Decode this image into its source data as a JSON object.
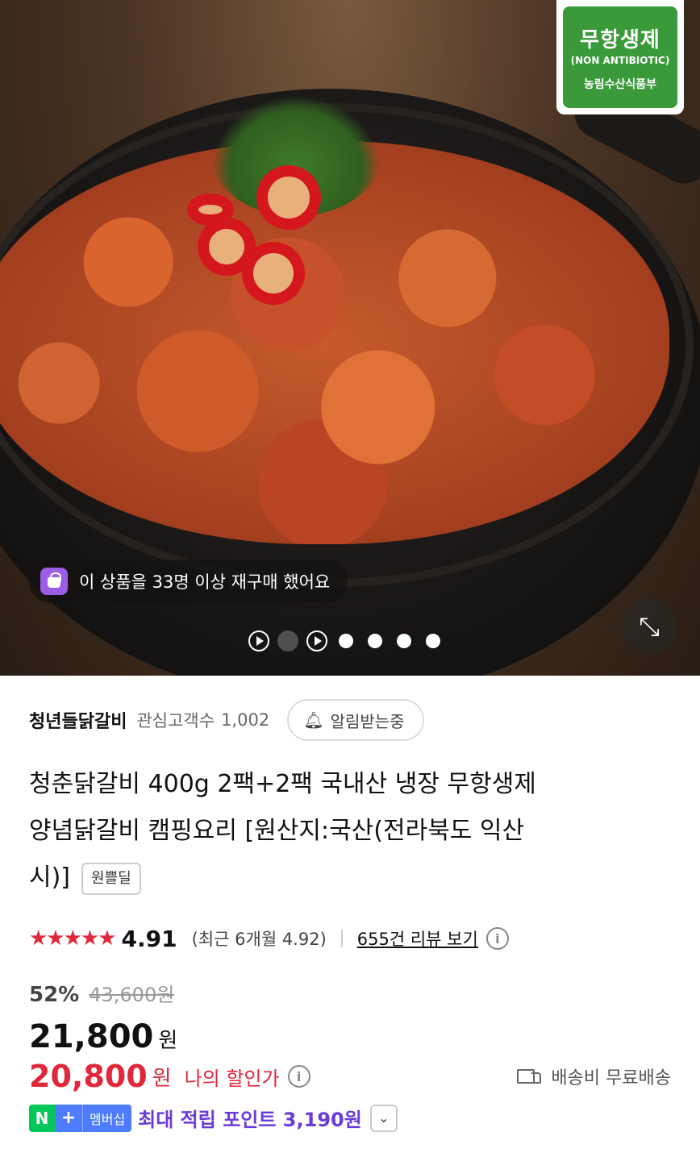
{
  "hero": {
    "certification": {
      "main": "무항생제",
      "sub": "(NON ANTIBIOTIC)",
      "org": "농림수산식품부"
    },
    "rebuy_text": "이 상품을 33명 이상 재구매 했어요",
    "carousel": {
      "total_slides": 7,
      "active_slide": 2
    }
  },
  "store": {
    "name": "청년들닭갈비",
    "follower_label": "관심고객수",
    "follower_count": "1,002",
    "notify_label": "알림받는중"
  },
  "product": {
    "title": "청춘닭갈비 400g 2팩+2팩 국내산 냉장 무항생제 양념닭갈비 캠핑요리 [원산지:국산(전라북도 익산시)]",
    "title_lines": [
      "청춘닭갈비 400g 2팩+2팩 국내산 냉장 무항생제",
      "양념닭갈비 캠핑요리 [원산지:국산(전라북도 익산",
      "시)]"
    ],
    "tag": "원쁠딜"
  },
  "rating": {
    "stars": "★★★★★",
    "score": "4.91",
    "recent": "(최근 6개월 4.92)",
    "reviews_link": "655건 리뷰 보기"
  },
  "price": {
    "discount_pct": "52%",
    "original": "43,600원",
    "sale": "21,800",
    "unit": "원",
    "my_price": "20,800",
    "my_unit": "원",
    "my_label": "나의 할인가",
    "shipping": "배송비 무료배송"
  },
  "points": {
    "badge_n": "N",
    "badge_plus": "+",
    "badge_member": "멤버십",
    "text": "최대 적립 포인트 3,190원"
  },
  "colors": {
    "accent_red": "#e0283b",
    "point_purple": "#6a3bd9",
    "naver_green": "#03c75a",
    "cert_green": "#3a9a3a"
  }
}
